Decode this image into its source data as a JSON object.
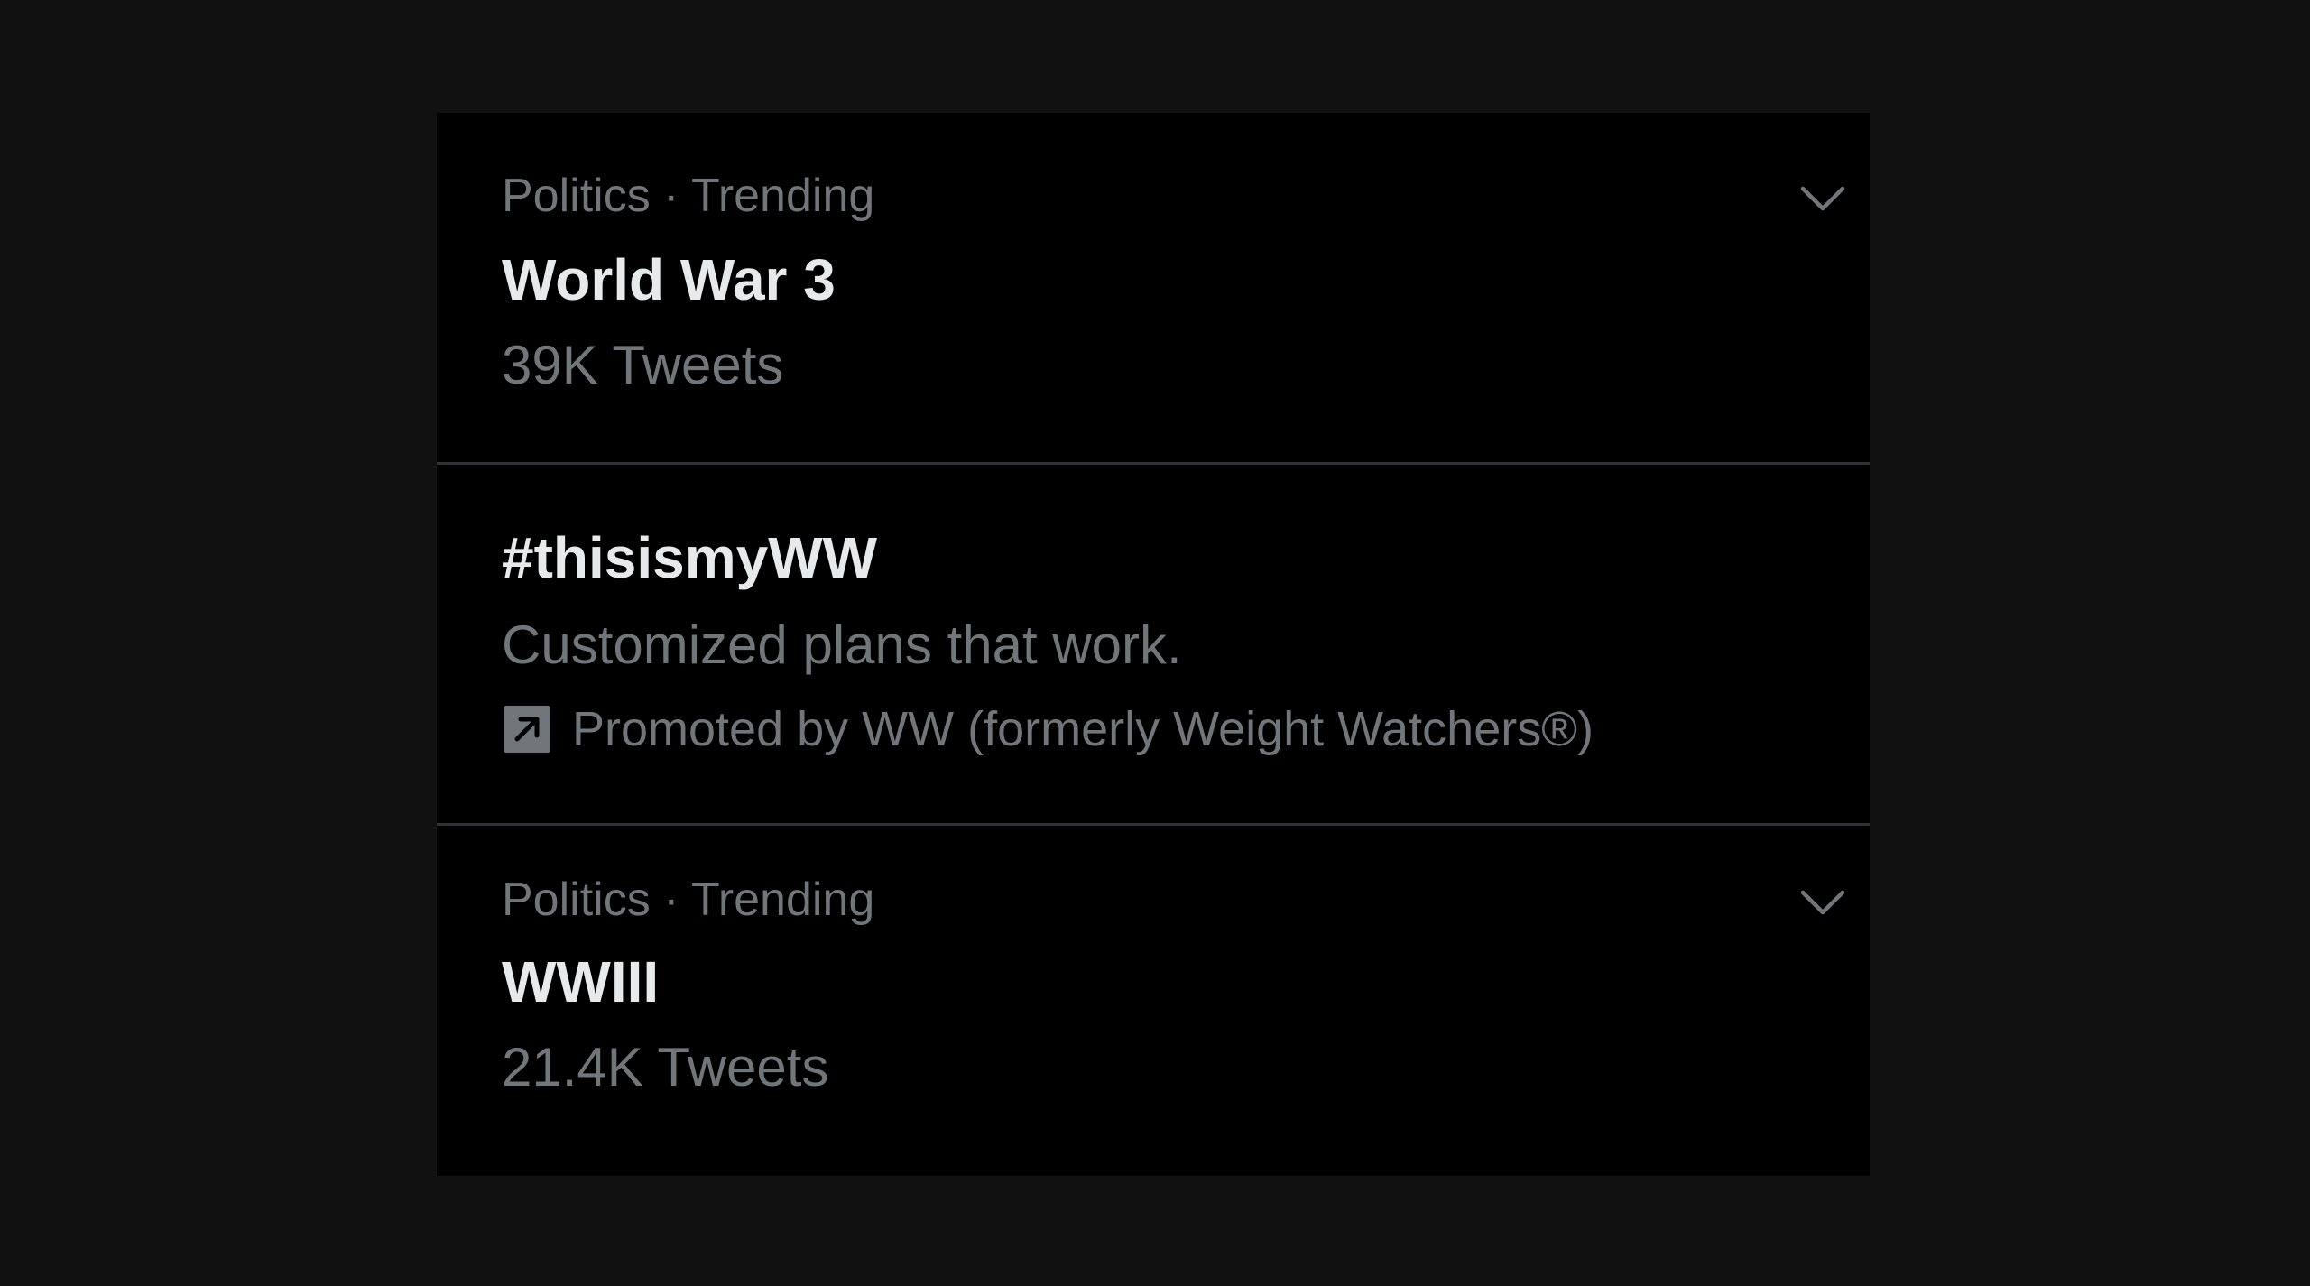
{
  "trends": [
    {
      "meta": "Politics · Trending",
      "title": "World War 3",
      "count": "39K Tweets",
      "menu_icon": "chevron-down-icon"
    },
    {
      "title": "#thisismyWW",
      "description": "Customized plans that work.",
      "promoted": "Promoted by WW (formerly Weight Watchers®)",
      "promoted_icon": "promoted-arrow-icon"
    },
    {
      "meta": "Politics · Trending",
      "title": "WWIII",
      "count": "21.4K Tweets",
      "menu_icon": "chevron-down-icon"
    }
  ],
  "colors": {
    "page_background": "#111112",
    "panel_background": "#000000",
    "primary_text": "#e7e9ea",
    "secondary_text": "#71767b",
    "divider": "#2f3336"
  }
}
